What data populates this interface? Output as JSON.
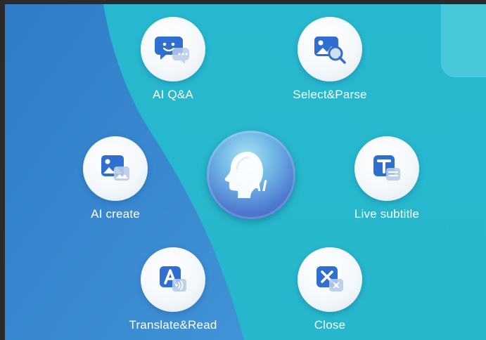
{
  "menu": {
    "items": [
      {
        "id": "ai-qa",
        "label": "AI Q&A",
        "icon": "chat-bubble-icon"
      },
      {
        "id": "select-parse",
        "label": "Select&Parse",
        "icon": "image-search-icon"
      },
      {
        "id": "ai-create",
        "label": "AI create",
        "icon": "image-create-icon"
      },
      {
        "id": "live-subtitle",
        "label": "Live subtitle",
        "icon": "subtitle-icon"
      },
      {
        "id": "translate-read",
        "label": "Translate&Read",
        "icon": "translate-audio-icon"
      },
      {
        "id": "close",
        "label": "Close",
        "icon": "close-icon"
      }
    ]
  },
  "center": {
    "label": "AI",
    "icon": "ai-head-icon"
  },
  "colors": {
    "background_teal": "#26b7cc",
    "background_blue": "#3a86cf",
    "icon_blue": "#2f6fd0",
    "label_white": "#ffffff"
  }
}
